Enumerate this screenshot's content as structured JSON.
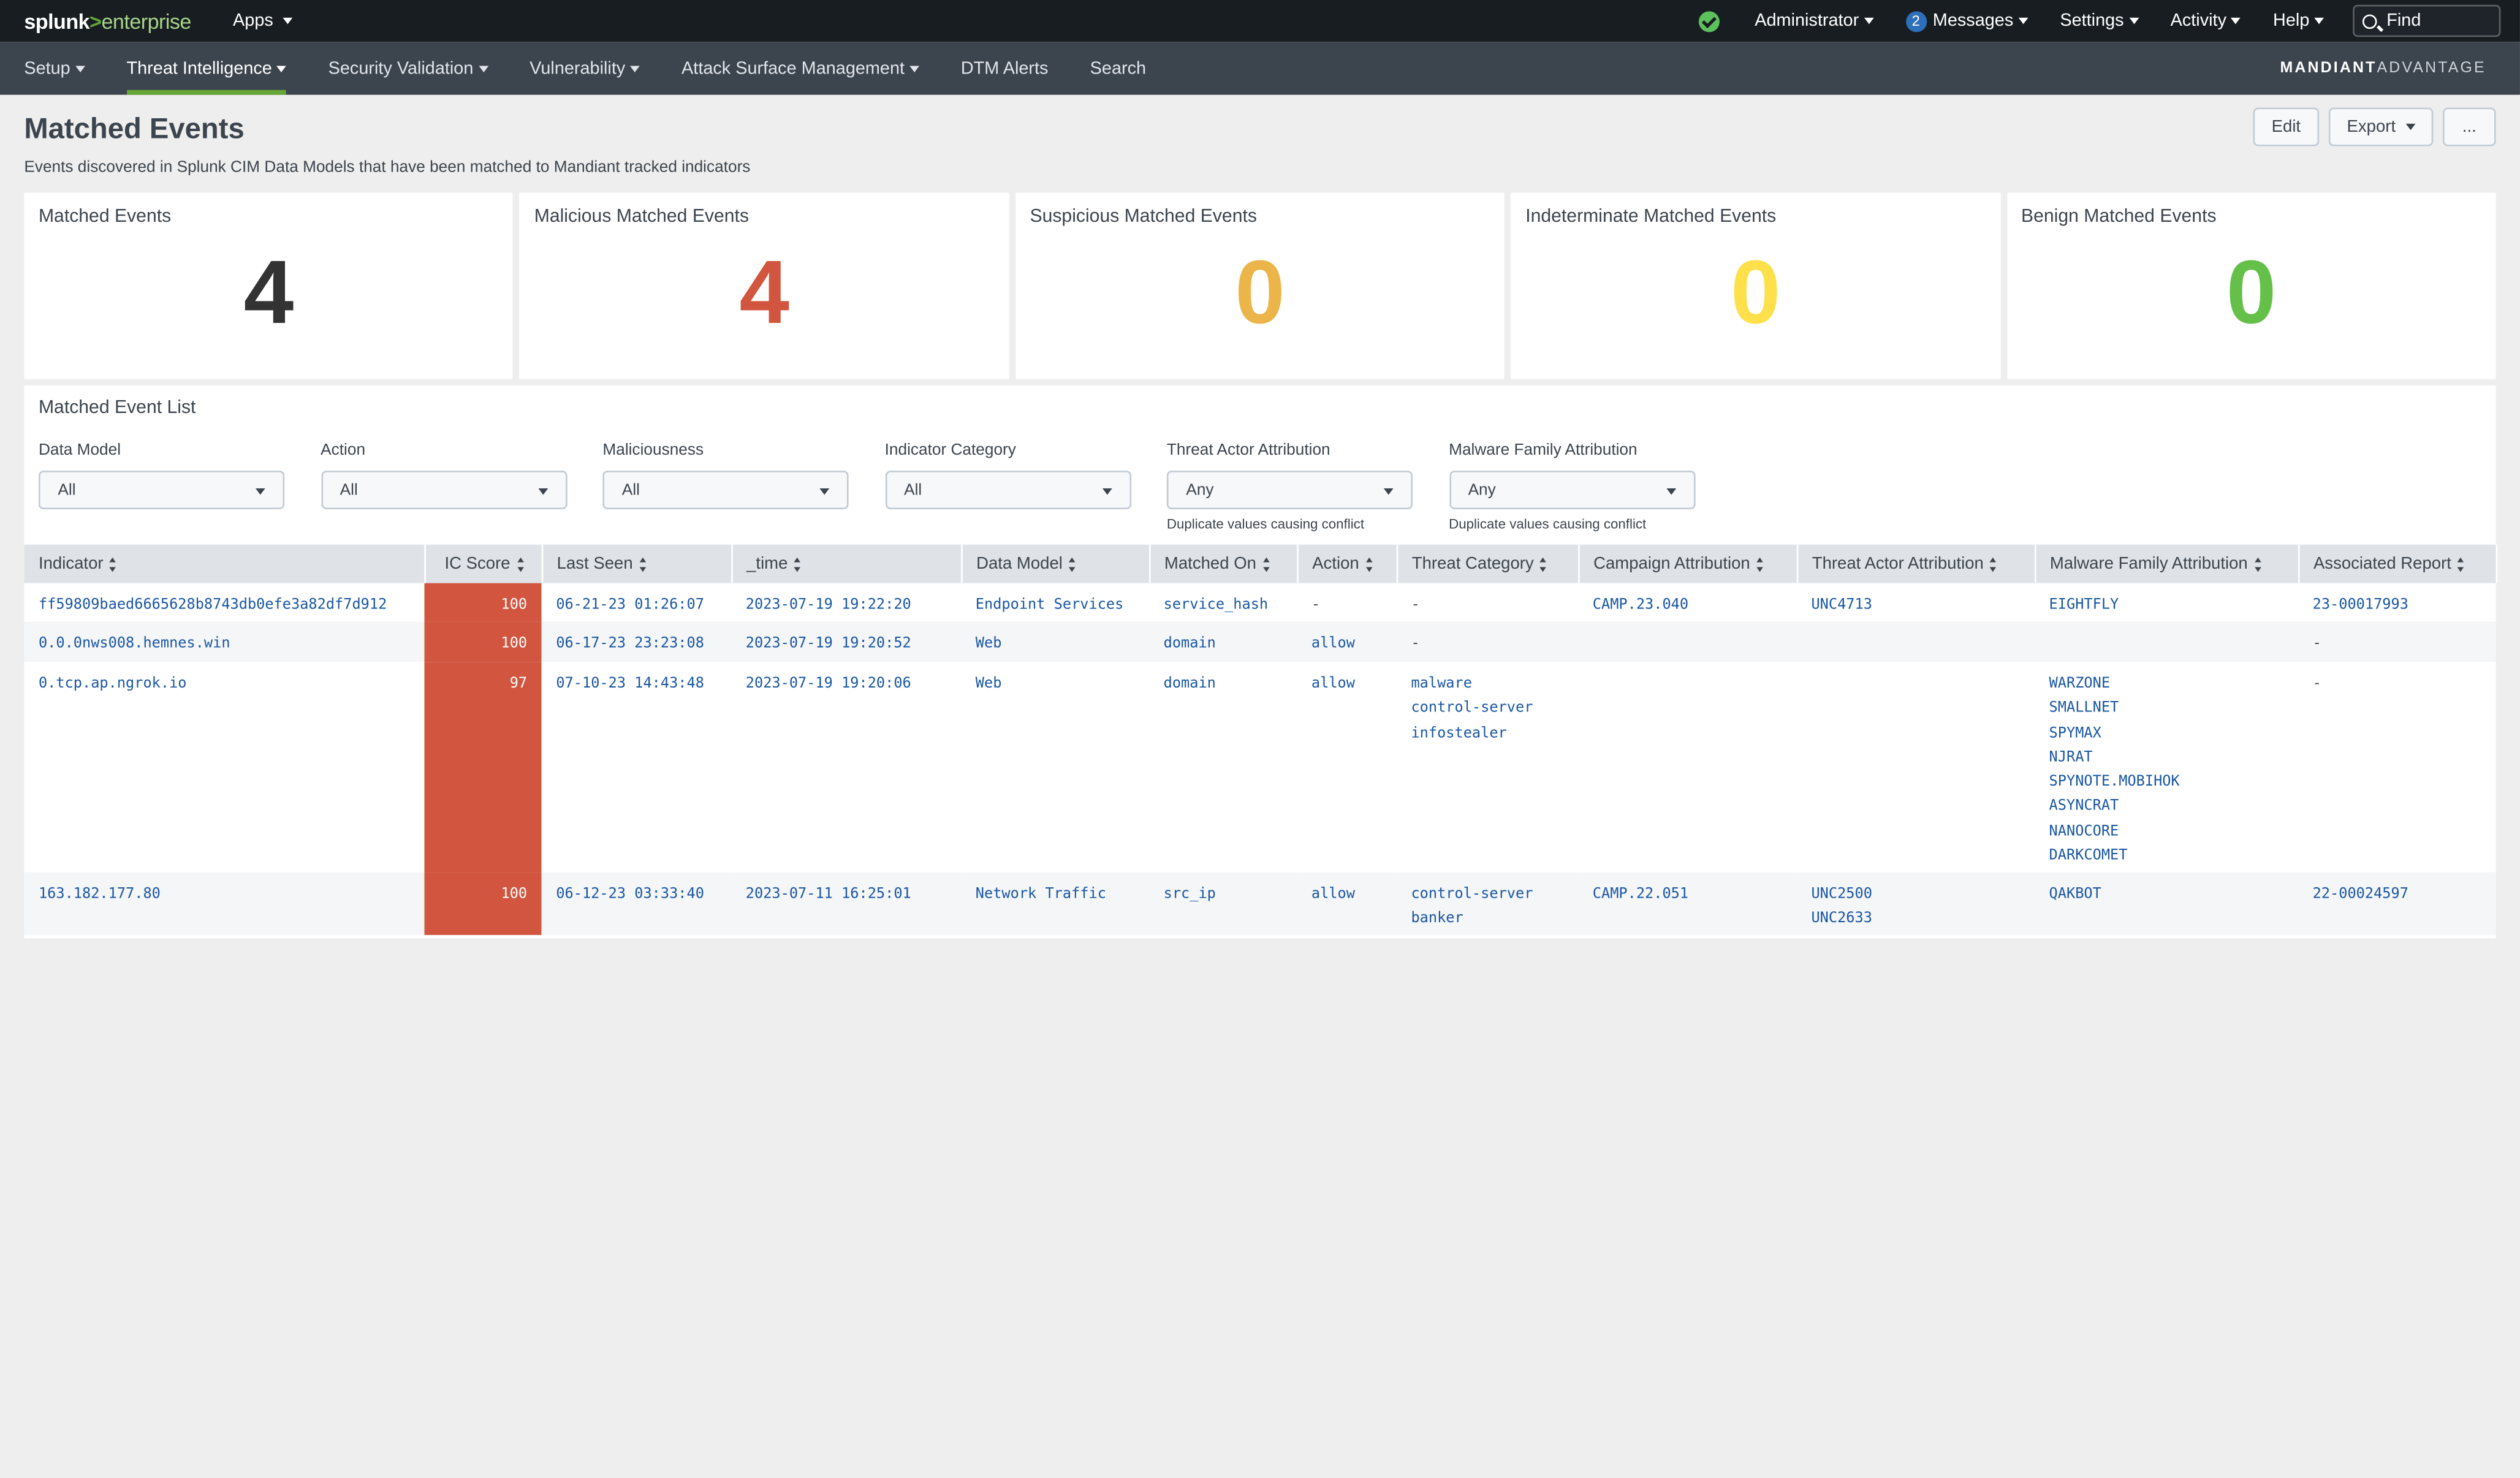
{
  "topbar": {
    "logo_brand": "splunk",
    "logo_sep": ">",
    "logo_product": "enterprise",
    "apps": "Apps",
    "administrator": "Administrator",
    "messages_count": "2",
    "messages": "Messages",
    "settings": "Settings",
    "activity": "Activity",
    "help": "Help",
    "find_placeholder": "Find"
  },
  "nav": {
    "items": [
      "Setup",
      "Threat Intelligence",
      "Security Validation",
      "Vulnerability",
      "Attack Surface Management",
      "DTM Alerts",
      "Search"
    ],
    "active_index": 1,
    "brand_bold": "MANDIANT",
    "brand_light": "ADVANTAGE"
  },
  "header": {
    "title": "Matched Events",
    "description": "Events discovered in Splunk CIM Data Models that have been matched to Mandiant tracked indicators",
    "edit": "Edit",
    "export": "Export",
    "more": "..."
  },
  "stats": [
    {
      "label": "Matched Events",
      "value": "4",
      "color": "#333333"
    },
    {
      "label": "Malicious Matched Events",
      "value": "4",
      "color": "#d1553f"
    },
    {
      "label": "Suspicious Matched Events",
      "value": "0",
      "color": "#ecb54a"
    },
    {
      "label": "Indeterminate Matched Events",
      "value": "0",
      "color": "#fde04a"
    },
    {
      "label": "Benign Matched Events",
      "value": "0",
      "color": "#65c04a"
    }
  ],
  "list": {
    "title": "Matched Event List",
    "filters": [
      {
        "label": "Data Model",
        "value": "All",
        "warning": ""
      },
      {
        "label": "Action",
        "value": "All",
        "warning": ""
      },
      {
        "label": "Maliciousness",
        "value": "All",
        "warning": ""
      },
      {
        "label": "Indicator Category",
        "value": "All",
        "warning": ""
      },
      {
        "label": "Threat Actor Attribution",
        "value": "Any",
        "warning": "Duplicate values causing conflict"
      },
      {
        "label": "Malware Family Attribution",
        "value": "Any",
        "warning": "Duplicate values causing conflict"
      }
    ],
    "columns": [
      "Indicator",
      "IC Score",
      "Last Seen",
      "_time",
      "Data Model",
      "Matched On",
      "Action",
      "Threat Category",
      "Campaign Attribution",
      "Threat Actor Attribution",
      "Malware Family Attribution",
      "Associated Report"
    ],
    "rows": [
      {
        "indicator": "ff59809baed6665628b8743db0efe3a82df7d912",
        "score": "100",
        "last_seen": "06-21-23 01:26:07",
        "time": "2023-07-19 19:22:20",
        "data_model": "Endpoint Services",
        "matched_on": "service_hash",
        "action": "-",
        "threat_category": [
          "-"
        ],
        "campaign": "CAMP.23.040",
        "threat_actor": [
          "UNC4713"
        ],
        "malware": [
          "EIGHTFLY"
        ],
        "report": "23-00017993"
      },
      {
        "indicator": "0.0.0nws008.hemnes.win",
        "score": "100",
        "last_seen": "06-17-23 23:23:08",
        "time": "2023-07-19 19:20:52",
        "data_model": "Web",
        "matched_on": "domain",
        "action": "allow",
        "threat_category": [
          "-"
        ],
        "campaign": "",
        "threat_actor": [],
        "malware": [],
        "report": "-"
      },
      {
        "indicator": "0.tcp.ap.ngrok.io",
        "score": "97",
        "last_seen": "07-10-23 14:43:48",
        "time": "2023-07-19 19:20:06",
        "data_model": "Web",
        "matched_on": "domain",
        "action": "allow",
        "threat_category": [
          "malware",
          "control-server",
          "infostealer"
        ],
        "campaign": "",
        "threat_actor": [],
        "malware": [
          "WARZONE",
          "SMALLNET",
          "SPYMAX",
          "NJRAT",
          "SPYNOTE.MOBIHOK",
          "ASYNCRAT",
          "NANOCORE",
          "DARKCOMET"
        ],
        "report": "-"
      },
      {
        "indicator": "163.182.177.80",
        "score": "100",
        "last_seen": "06-12-23 03:33:40",
        "time": "2023-07-11 16:25:01",
        "data_model": "Network Traffic",
        "matched_on": "src_ip",
        "action": "allow",
        "threat_category": [
          "control-server",
          "banker"
        ],
        "campaign": "CAMP.22.051",
        "threat_actor": [
          "UNC2500",
          "UNC2633"
        ],
        "malware": [
          "QAKBOT"
        ],
        "report": "22-00024597"
      }
    ]
  }
}
